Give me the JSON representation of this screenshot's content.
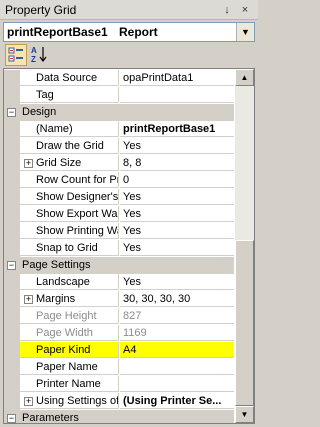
{
  "panel": {
    "title": "Property Grid",
    "pin_glyph": "↓",
    "close_glyph": "×"
  },
  "object_selector": {
    "name": "printReportBase1",
    "type": "Report",
    "dropdown_glyph": "▼"
  },
  "toolbar": {
    "categorized_label": "Categorized",
    "alphabetical_label": "Alphabetical",
    "categorized_pressed": true
  },
  "grid": {
    "rows": [
      {
        "kind": "prop",
        "name": "Data Source",
        "value": "opaPrintData1"
      },
      {
        "kind": "prop",
        "name": "Tag",
        "value": ""
      },
      {
        "kind": "cat",
        "label": "Design",
        "expanded": true
      },
      {
        "kind": "prop",
        "name": "(Name)",
        "value": "printReportBase1",
        "bold": true
      },
      {
        "kind": "prop",
        "name": "Draw the Grid",
        "value": "Yes"
      },
      {
        "kind": "prop",
        "name": "Grid Size",
        "value": "8, 8",
        "expandable": true
      },
      {
        "kind": "prop",
        "name": "Row Count for Pr",
        "value": "0"
      },
      {
        "kind": "prop",
        "name": "Show Designer's",
        "value": "Yes"
      },
      {
        "kind": "prop",
        "name": "Show Export Wa",
        "value": "Yes"
      },
      {
        "kind": "prop",
        "name": "Show Printing Wa",
        "value": "Yes"
      },
      {
        "kind": "prop",
        "name": "Snap to Grid",
        "value": "Yes"
      },
      {
        "kind": "cat",
        "label": "Page Settings",
        "expanded": true
      },
      {
        "kind": "prop",
        "name": "Landscape",
        "value": "Yes"
      },
      {
        "kind": "prop",
        "name": "Margins",
        "value": "30, 30, 30, 30",
        "expandable": true
      },
      {
        "kind": "prop",
        "name": "Page Height",
        "value": "827",
        "disabled": true
      },
      {
        "kind": "prop",
        "name": "Page Width",
        "value": "1169",
        "disabled": true
      },
      {
        "kind": "prop",
        "name": "Paper Kind",
        "value": "A4",
        "highlight": true
      },
      {
        "kind": "prop",
        "name": "Paper Name",
        "value": ""
      },
      {
        "kind": "prop",
        "name": "Printer Name",
        "value": ""
      },
      {
        "kind": "prop",
        "name": "Using Settings of",
        "value": "(Using Printer Se...",
        "bold": true,
        "expandable": true
      },
      {
        "kind": "cat",
        "label": "Parameters",
        "expanded": true
      }
    ]
  },
  "scrollbar": {
    "up_glyph": "▲",
    "down_glyph": "▼"
  },
  "colors": {
    "highlight": "#ffff00",
    "category_bg": "#d4d0c8",
    "disabled_text": "#8c8c8c"
  }
}
